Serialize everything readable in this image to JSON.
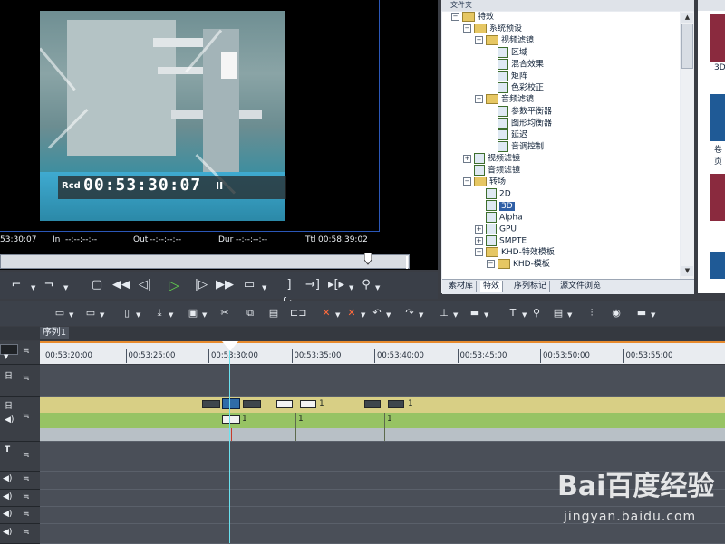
{
  "preview": {
    "timecode_prefix": "Rcd",
    "timecode": "00:53:30:07",
    "pause_glyph": "II",
    "info": {
      "current": "53:30:07",
      "in_label": "In",
      "in_value": "--:--:--:--",
      "out_label": "Out",
      "out_value": "--:--:--:--",
      "dur_label": "Dur",
      "dur_value": "--:--:--:--",
      "ttl_label": "Ttl",
      "ttl_value": "00:58:39:02"
    },
    "scrubber_position": 0.9
  },
  "transport_icons": [
    "set-in-icon",
    "set-out-icon",
    "stop-icon",
    "rewind-icon",
    "step-back-icon",
    "play-icon",
    "step-forward-icon",
    "fast-forward-icon",
    "output-icon",
    "goto-in-icon",
    "goto-out-icon",
    "play-in-out-icon",
    "match-frame-icon"
  ],
  "folder_panel": {
    "title": "文件夹",
    "tree": [
      {
        "label": "特效",
        "level": 0,
        "expand": "−",
        "kind": "folder"
      },
      {
        "label": "系统预设",
        "level": 1,
        "expand": "−",
        "kind": "folder"
      },
      {
        "label": "视频滤镜",
        "level": 2,
        "expand": "−",
        "kind": "folder"
      },
      {
        "label": "区域",
        "level": 3,
        "kind": "fx"
      },
      {
        "label": "混合效果",
        "level": 3,
        "kind": "fx"
      },
      {
        "label": "矩阵",
        "level": 3,
        "kind": "fx"
      },
      {
        "label": "色彩校正",
        "level": 3,
        "kind": "fx"
      },
      {
        "label": "音频滤镜",
        "level": 2,
        "expand": "−",
        "kind": "folder"
      },
      {
        "label": "参数平衡器",
        "level": 3,
        "kind": "fx"
      },
      {
        "label": "图形均衡器",
        "level": 3,
        "kind": "fx"
      },
      {
        "label": "延迟",
        "level": 3,
        "kind": "fx"
      },
      {
        "label": "音调控制",
        "level": 3,
        "kind": "fx"
      },
      {
        "label": "视频滤镜",
        "level": 1,
        "expand": "+",
        "kind": "fx"
      },
      {
        "label": "音频滤镜",
        "level": 1,
        "kind": "fx"
      },
      {
        "label": "转场",
        "level": 1,
        "expand": "−",
        "kind": "folder"
      },
      {
        "label": "2D",
        "level": 2,
        "kind": "fx"
      },
      {
        "label": "3D",
        "level": 2,
        "kind": "fx",
        "selected": true
      },
      {
        "label": "Alpha",
        "level": 2,
        "kind": "fx"
      },
      {
        "label": "GPU",
        "level": 2,
        "expand": "+",
        "kind": "fx"
      },
      {
        "label": "SMPTE",
        "level": 2,
        "expand": "+",
        "kind": "fx"
      },
      {
        "label": "KHD-特效模板",
        "level": 2,
        "expand": "−",
        "kind": "folder"
      },
      {
        "label": "KHD-模板",
        "level": 3,
        "expand": "−",
        "kind": "folder"
      }
    ],
    "tabs": [
      "素材库",
      "特效",
      "序列标记",
      "源文件浏览"
    ],
    "active_tab": 1
  },
  "thumbs": {
    "labels": [
      "3D",
      "卷页"
    ]
  },
  "toolbar_icons": [
    "video-fx-icon",
    "audio-fx-icon",
    "new-icon",
    "import-icon",
    "save-icon",
    "cut-icon",
    "copy-icon",
    "paste-icon",
    "link-icon",
    "delete-icon",
    "ripple-delete-icon",
    "undo-icon",
    "redo-icon",
    "split-icon",
    "razor-icon",
    "text-icon",
    "mic-icon",
    "render-icon",
    "mixer-icon",
    "color-icon",
    "settings-icon"
  ],
  "sequence": {
    "tab_label": "序列1",
    "ruler_ticks": [
      "00:53:20:00",
      "00:53:25:00",
      "00:53:30:00",
      "00:53:35:00",
      "00:53:40:00",
      "00:53:45:00",
      "00:53:50:00",
      "00:53:55:00"
    ],
    "clip_numbers": [
      "1",
      "1",
      "1",
      "1",
      "1"
    ]
  },
  "watermark": {
    "logo": "Bai百度经验",
    "url": "jingyan.baidu.com"
  }
}
